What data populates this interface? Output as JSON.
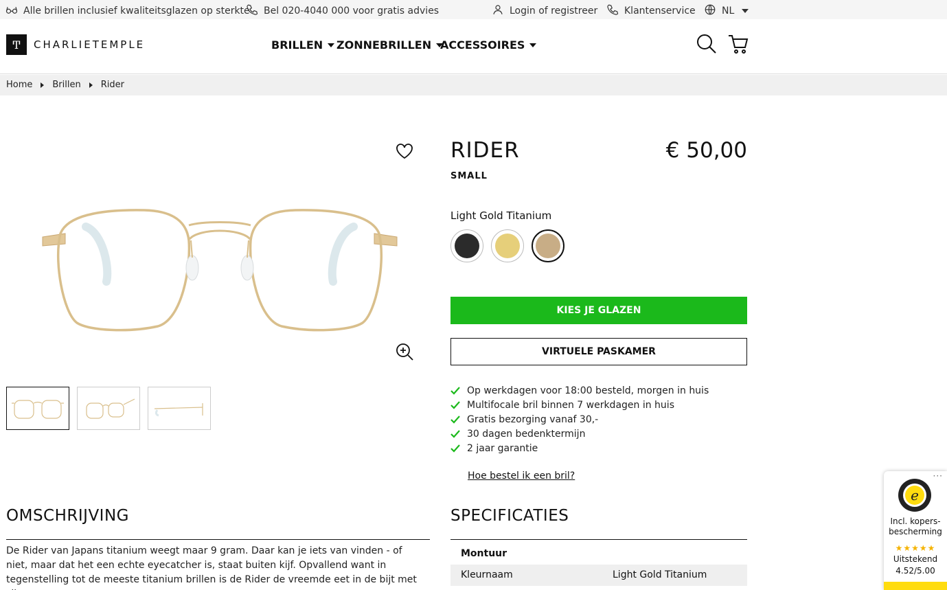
{
  "topbar": {
    "promo": "Alle brillen inclusief kwaliteitsglazen op sterkte",
    "phone": "Bel 020-4040 000 voor gratis advies",
    "login": "Login of registreer",
    "service": "Klantenservice",
    "language": "NL"
  },
  "header": {
    "logo_mark": "Ͳ",
    "logo_text": "CHARLIETEMPLE",
    "nav": [
      "BRILLEN",
      "ZONNEBRILLEN",
      "ACCESSOIRES"
    ]
  },
  "breadcrumb": [
    "Home",
    "Brillen",
    "Rider"
  ],
  "product": {
    "title": "RIDER",
    "price": "€ 50,00",
    "size": "SMALL",
    "color_name": "Light Gold Titanium",
    "swatches": [
      {
        "color": "#2b2b2b",
        "selected": false
      },
      {
        "color": "#e6cf7a",
        "selected": false
      },
      {
        "color": "#c8ad86",
        "selected": true
      }
    ],
    "cta_primary": "KIES JE GLAZEN",
    "cta_secondary": "VIRTUELE PASKAMER",
    "usps": [
      "Op werkdagen voor 18:00 besteld, morgen in huis",
      "Multifocale bril binnen 7 werkdagen in huis",
      "Gratis bezorging vanaf 30,-",
      "30 dagen bedenktermijn",
      "2 jaar garantie"
    ],
    "howto_link": "Hoe bestel ik een bril?"
  },
  "description": {
    "title": "OMSCHRIJVING",
    "text": "De Rider van Japans titanium weegt maar 9 gram. Daar kan je iets van vinden - of niet, maar dat het een echte eyecatcher is, staat buiten kijf. Opvallend want in tegenstelling tot de meeste titanium brillen is de Rider de vreemde eet in de bijt met zijn stoere"
  },
  "specs": {
    "title": "SPECIFICATIES",
    "group": "Montuur",
    "rows": [
      {
        "key": "Kleurnaam",
        "value": "Light Gold Titanium"
      }
    ]
  },
  "trusted_shops": {
    "menu": "···",
    "line1": "Incl. kopers-bescherming",
    "stars": "★★★★★",
    "rating_label": "Uitstekend",
    "rating": "4.52/5.00"
  },
  "colors": {
    "accent_green": "#1bb91b",
    "frame_gold": "#d9bf8c",
    "badge_yellow": "#ffdc0f"
  }
}
